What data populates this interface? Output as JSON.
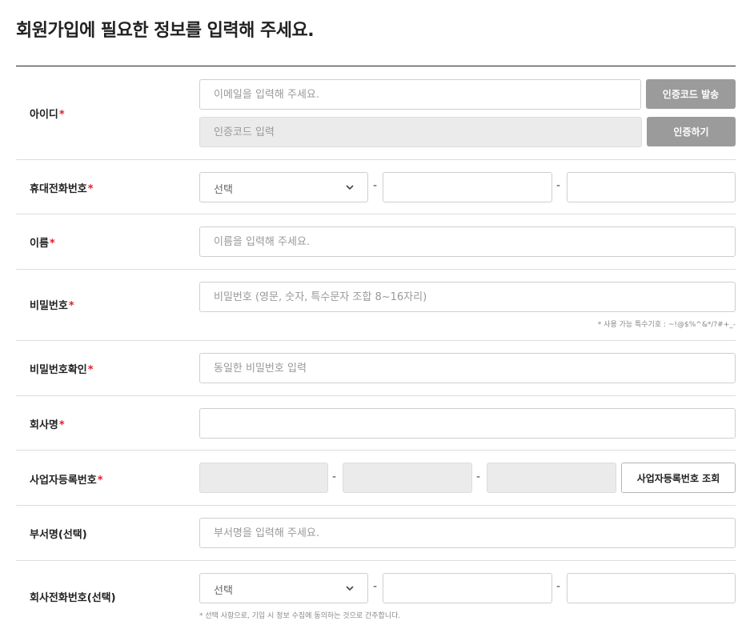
{
  "page": {
    "title": "회원가입에 필요한 정보를 입력해 주세요."
  },
  "required_mark": "*",
  "dash": "-",
  "fields": {
    "id": {
      "label": "아이디",
      "email_placeholder": "이메일을 입력해 주세요.",
      "send_code_button": "인증코드 발송",
      "code_placeholder": "인증코드 입력",
      "verify_button": "인증하기"
    },
    "mobile": {
      "label": "휴대전화번호",
      "select_value": "선택"
    },
    "name": {
      "label": "이름",
      "placeholder": "이름을 입력해 주세요."
    },
    "password": {
      "label": "비밀번호",
      "placeholder": "비밀번호 (영문, 숫자, 특수문자 조합 8~16자리)",
      "hint": "* 사용 가능 특수기호 : ~!@$%^&*/?#+_-"
    },
    "password_confirm": {
      "label": "비밀번호확인",
      "placeholder": "동일한 비밀번호 입력"
    },
    "company": {
      "label": "회사명"
    },
    "business_number": {
      "label": "사업자등록번호",
      "lookup_button": "사업자등록번호 조회"
    },
    "department": {
      "label": "부서명(선택)",
      "placeholder": "부서명을 입력해 주세요."
    },
    "company_phone": {
      "label": "회사전화번호(선택)",
      "select_value": "선택",
      "hint": "* 선택 사항으로, 기입 시 정보 수집에 동의하는 것으로 간주합니다."
    }
  },
  "icons": {
    "select_arrow": "chevron-down-icon"
  },
  "colors": {
    "required": "#e0202a",
    "button_gray": "#9b9b9b",
    "disabled_field": "#ebebeb"
  }
}
